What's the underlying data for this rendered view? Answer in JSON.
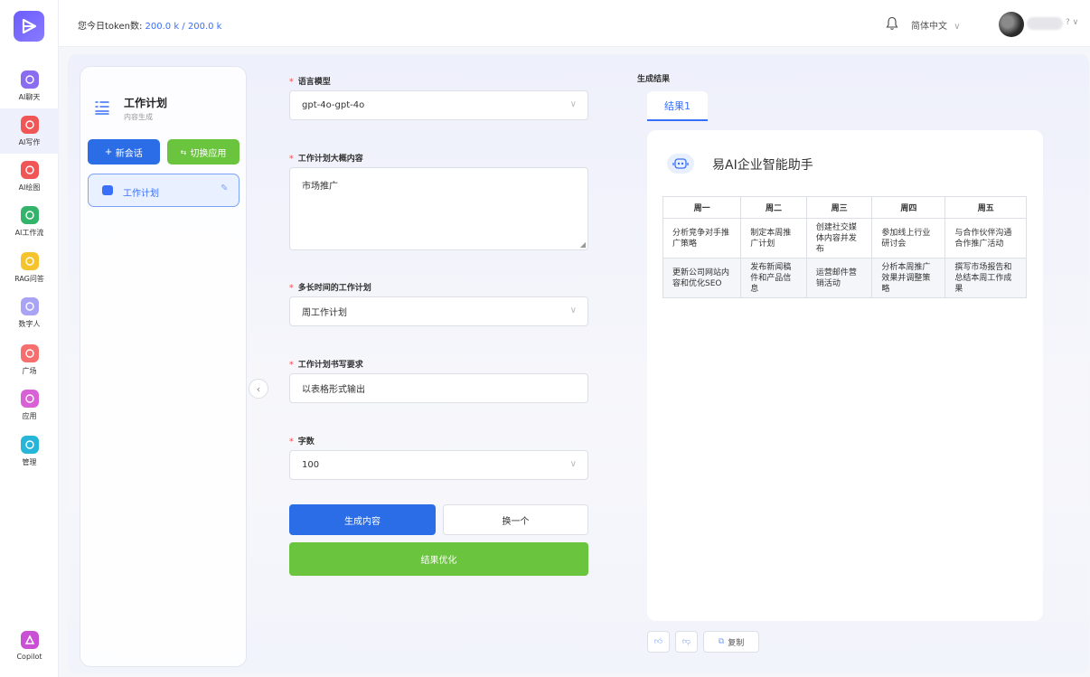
{
  "topbar": {
    "token_label": "您今日token数:",
    "token_value": "200.0 k / 200.0 k",
    "language": "简体中文",
    "user_caret": "? ∨"
  },
  "rail": {
    "items": [
      {
        "label": "AI聊天",
        "icon": "chat-icon",
        "color": "#8a6cf0"
      },
      {
        "label": "AI写作",
        "icon": "pen-icon",
        "color": "#f05656"
      },
      {
        "label": "AI绘图",
        "icon": "paint-icon",
        "color": "#f05656"
      },
      {
        "label": "AI工作流",
        "icon": "workflow-icon",
        "color": "#34b36b"
      },
      {
        "label": "RAG问答",
        "icon": "qa-icon",
        "color": "#f5c32c"
      },
      {
        "label": "数字人",
        "icon": "digital-human-icon",
        "color": "#a9a3f5"
      },
      {
        "label": "广场",
        "icon": "plaza-icon",
        "color": "#f56f6f"
      },
      {
        "label": "应用",
        "icon": "apps-icon",
        "color": "#d861d6"
      },
      {
        "label": "管理",
        "icon": "manage-icon",
        "color": "#27b5d8"
      }
    ],
    "copilot": {
      "label": "Copilot",
      "icon": "copilot-icon",
      "color": "#c94fd4"
    }
  },
  "app_panel": {
    "title": "工作计划",
    "subtitle": "内容生成",
    "new_button": "新会话",
    "switch_button": "切换应用",
    "session_label": "工作计划"
  },
  "form": {
    "model_label": "语言模型",
    "model_value": "gpt-4o-gpt-4o",
    "content_label": "工作计划大概内容",
    "content_value": "市场推广",
    "period_label": "多长时间的工作计划",
    "period_value": "周工作计划",
    "req_label": "工作计划书写要求",
    "req_value": "以表格形式输出",
    "words_label": "字数",
    "words_value": "100",
    "generate_button": "生成内容",
    "swap_button": "换一个",
    "optimize_button": "结果优化"
  },
  "result": {
    "label": "生成结果",
    "tab": "结果1",
    "brand": "易AI企业智能助手",
    "headers": [
      "周一",
      "周二",
      "周三",
      "周四",
      "周五"
    ],
    "rows": [
      [
        "分析竞争对手推广策略",
        "制定本周推广计划",
        "创建社交媒体内容并发布",
        "参加线上行业研讨会",
        "与合作伙伴沟通合作推广活动"
      ],
      [
        "更新公司网站内容和优化SEO",
        "发布新闻稿件和产品信息",
        "运营邮件营销活动",
        "分析本周推广效果并调整策略",
        "撰写市场报告和总结本周工作成果"
      ]
    ],
    "copy_button": "复制"
  }
}
